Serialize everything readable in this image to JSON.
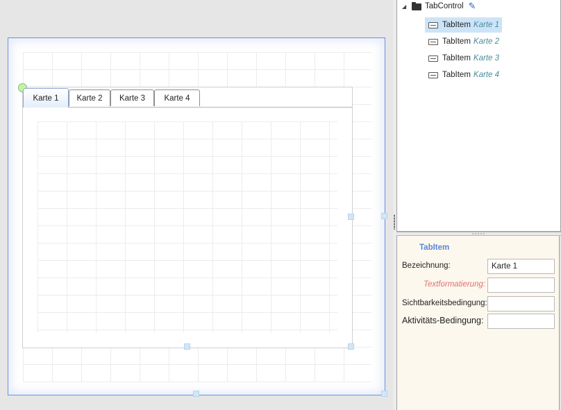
{
  "designer": {
    "tabs": [
      {
        "label": "Karte 1",
        "active": true
      },
      {
        "label": "Karte 2",
        "active": false
      },
      {
        "label": "Karte 3",
        "active": false
      },
      {
        "label": "Karte 4",
        "active": false
      }
    ]
  },
  "tree": {
    "root": {
      "label": "TabControl",
      "icon": "folder-icon",
      "edit_icon": "pencil-icon"
    },
    "items": [
      {
        "type": "TabItem",
        "name": "Karte 1",
        "selected": true
      },
      {
        "type": "TabItem",
        "name": "Karte 2",
        "selected": false
      },
      {
        "type": "TabItem",
        "name": "Karte 3",
        "selected": false
      },
      {
        "type": "TabItem",
        "name": "Karte 4",
        "selected": false
      }
    ]
  },
  "properties": {
    "title": "TabItem",
    "fields": {
      "bezeichnung": {
        "label": "Bezeichnung:",
        "value": "Karte 1"
      },
      "textformatierung": {
        "label": "Textformatierung:",
        "value": ""
      },
      "sichtbarkeit": {
        "label": "Sichtbarkeitsbedingung:",
        "value": ""
      },
      "aktivitaet": {
        "label": "Aktivitäts-Bedingung:",
        "value": ""
      }
    }
  },
  "colors": {
    "selection_border": "#6f8fe0",
    "tree_selected_bg": "#cce4f7",
    "item_name_color": "#4a8c9c",
    "props_title_color": "#5a86d6",
    "formatting_label_color": "#e07070",
    "props_panel_bg": "#fdf8ee"
  }
}
